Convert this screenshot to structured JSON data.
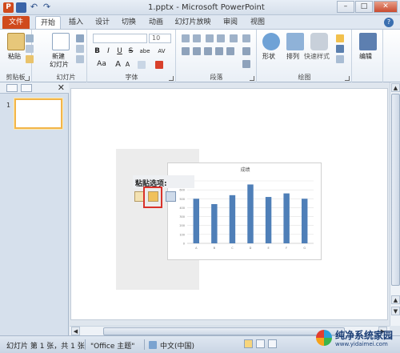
{
  "window": {
    "title": "1.pptx - Microsoft PowerPoint",
    "app_logo": "P",
    "min": "–",
    "max": "□",
    "close": "✕"
  },
  "tabs": [
    "文件",
    "开始",
    "插入",
    "设计",
    "切换",
    "动画",
    "幻灯片放映",
    "审阅",
    "视图"
  ],
  "ribbon": {
    "clipboard": {
      "label": "剪贴板",
      "paste": "粘贴"
    },
    "slides": {
      "label": "幻灯片",
      "new_slide_1": "新建",
      "new_slide_2": "幻灯片"
    },
    "font": {
      "label": "字体",
      "size": "10",
      "bold": "B",
      "italic": "I",
      "underline": "U",
      "strike": "S",
      "shadow": "abe",
      "spacing": "AV",
      "case": "Aa",
      "grow": "A",
      "shrink": "A"
    },
    "paragraph": {
      "label": "段落"
    },
    "drawing": {
      "label": "绘图",
      "shapes": "形状",
      "arrange": "排列",
      "quick_styles": "快速样式"
    },
    "editing": {
      "label": "编辑"
    }
  },
  "thumbnails": {
    "slide_number": "1"
  },
  "slide": {
    "paste_options_label": "粘贴选项:",
    "chart_data": {
      "type": "bar",
      "title": "成绩",
      "categories": [
        "A",
        "B",
        "C",
        "D",
        "E",
        "F",
        "G"
      ],
      "values": [
        500,
        440,
        540,
        660,
        520,
        560,
        500
      ],
      "ylim": [
        0,
        700
      ],
      "yticks": [
        "700",
        "600",
        "500",
        "400",
        "300",
        "200",
        "100",
        "0"
      ],
      "bar_color": "#4f7fb8"
    }
  },
  "status": {
    "slide_info": "幻灯片 第 1 张，共 1 张",
    "theme": "\"Office 主题\"",
    "language": "中文(中国)"
  },
  "watermark": {
    "text": "纯净系统家园",
    "url": "www.yidaimei.com"
  },
  "colors": {
    "file_tab": "#d04a1d",
    "accent": "#2c5b96",
    "highlight": "#d9322a"
  }
}
